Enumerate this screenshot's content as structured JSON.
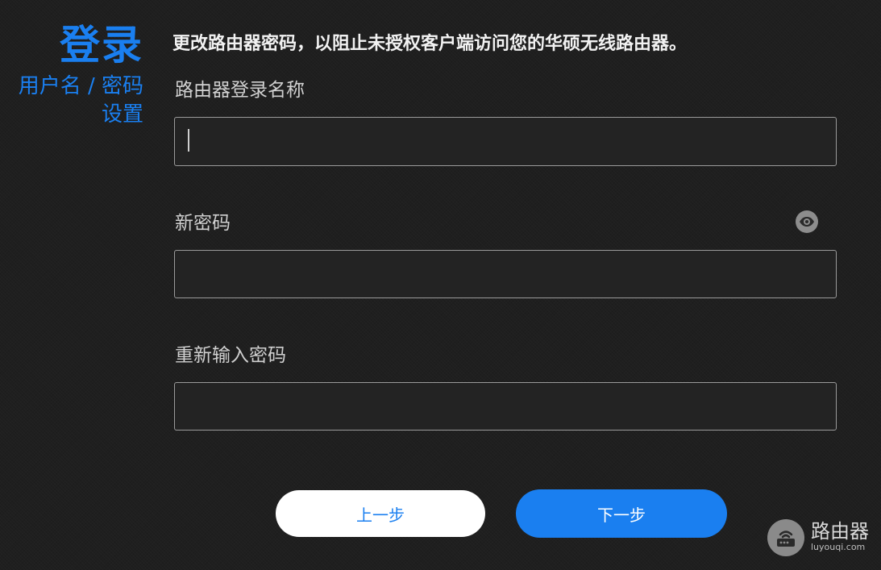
{
  "sidebar": {
    "title": "登录",
    "subtitle_line1": "用户名 / 密码",
    "subtitle_line2": "设置"
  },
  "main": {
    "heading": "更改路由器密码，以阻止未授权客户端访问您的华硕无线路由器。",
    "fields": [
      {
        "label": "路由器登录名称",
        "value": "",
        "placeholder": ""
      },
      {
        "label": "新密码",
        "value": "",
        "placeholder": ""
      },
      {
        "label": "重新输入密码",
        "value": "",
        "placeholder": ""
      }
    ],
    "show_password_icon": "eye-icon"
  },
  "buttons": {
    "prev_label": "上一步",
    "next_label": "下一步"
  },
  "watermark": {
    "title": "路由器",
    "url": "luyouqi.com",
    "icon": "router-icon"
  },
  "colors": {
    "accent": "#1a7ff0",
    "background": "#1f1f1f",
    "field_border": "#9a9a9a"
  }
}
